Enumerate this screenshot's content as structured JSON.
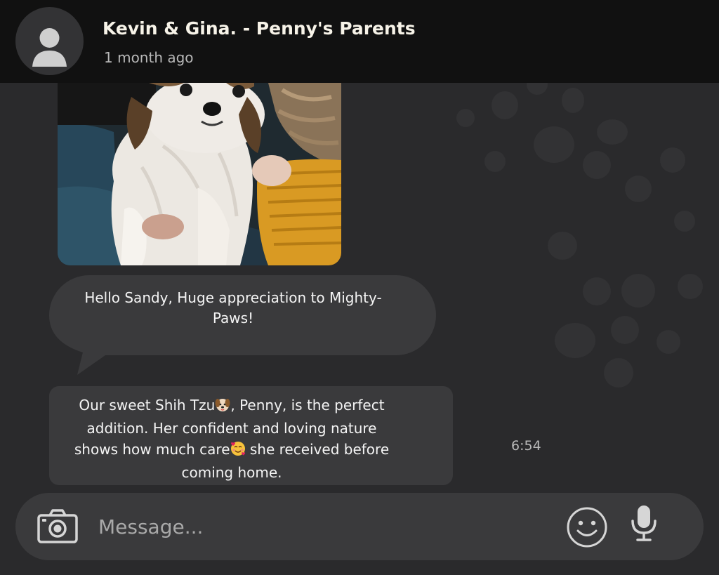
{
  "header": {
    "title": "Kevin & Gina. - Penny's Parents",
    "subtitle": "1 month ago"
  },
  "messages": [
    {
      "type": "image",
      "icon": "puppy-photo"
    },
    {
      "type": "text",
      "text": "Hello Sandy, Huge appreciation to Mighty-Paws!"
    },
    {
      "type": "text",
      "part1": "Our sweet Shih Tzu",
      "emoji1": "dog-face-emoji",
      "part2": ", Penny, is the perfect addition. Her confident and loving nature shows how much care",
      "emoji2": "smiling-face-with-hearts-emoji",
      "part3": " she received before coming home.",
      "time": "6:54"
    }
  ],
  "composer": {
    "placeholder": "Message...",
    "icons": [
      "camera-icon",
      "emoji-icon",
      "microphone-icon"
    ]
  },
  "colors": {
    "header_bg": "#111111",
    "screen_bg": "#2a2a2c",
    "bubble_bg": "#3a3a3c",
    "title_color": "#f7f3e8"
  }
}
